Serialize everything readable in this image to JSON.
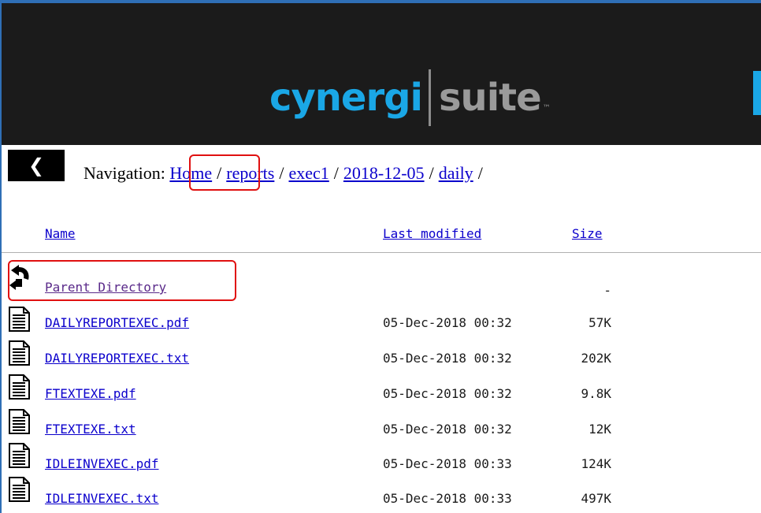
{
  "header": {
    "logo_word_1": "cynergi",
    "logo_word_2": "suite",
    "logo_tm": "™",
    "brand_color": "#1aa7e6"
  },
  "nav": {
    "back_label": "❮",
    "label": "Navigation:",
    "crumbs": [
      {
        "label": "Home"
      },
      {
        "label": "reports"
      },
      {
        "label": "exec1"
      },
      {
        "label": "2018-12-05"
      },
      {
        "label": "daily"
      }
    ],
    "separator": "/"
  },
  "columns": {
    "name": "Name",
    "last_modified": "Last modified",
    "size": "Size"
  },
  "parent": {
    "label": "Parent Directory",
    "size": "-"
  },
  "files": [
    {
      "name": "DAILYREPORTEXEC.pdf",
      "modified": "05-Dec-2018 00:32",
      "size": "57K"
    },
    {
      "name": "DAILYREPORTEXEC.txt",
      "modified": "05-Dec-2018 00:32",
      "size": "202K"
    },
    {
      "name": "FTEXTEXE.pdf",
      "modified": "05-Dec-2018 00:32",
      "size": "9.8K"
    },
    {
      "name": "FTEXTEXE.txt",
      "modified": "05-Dec-2018 00:32",
      "size": "12K"
    },
    {
      "name": "IDLEINVEXEC.pdf",
      "modified": "05-Dec-2018 00:33",
      "size": "124K"
    },
    {
      "name": "IDLEINVEXEC.txt",
      "modified": "05-Dec-2018 00:33",
      "size": "497K"
    }
  ]
}
